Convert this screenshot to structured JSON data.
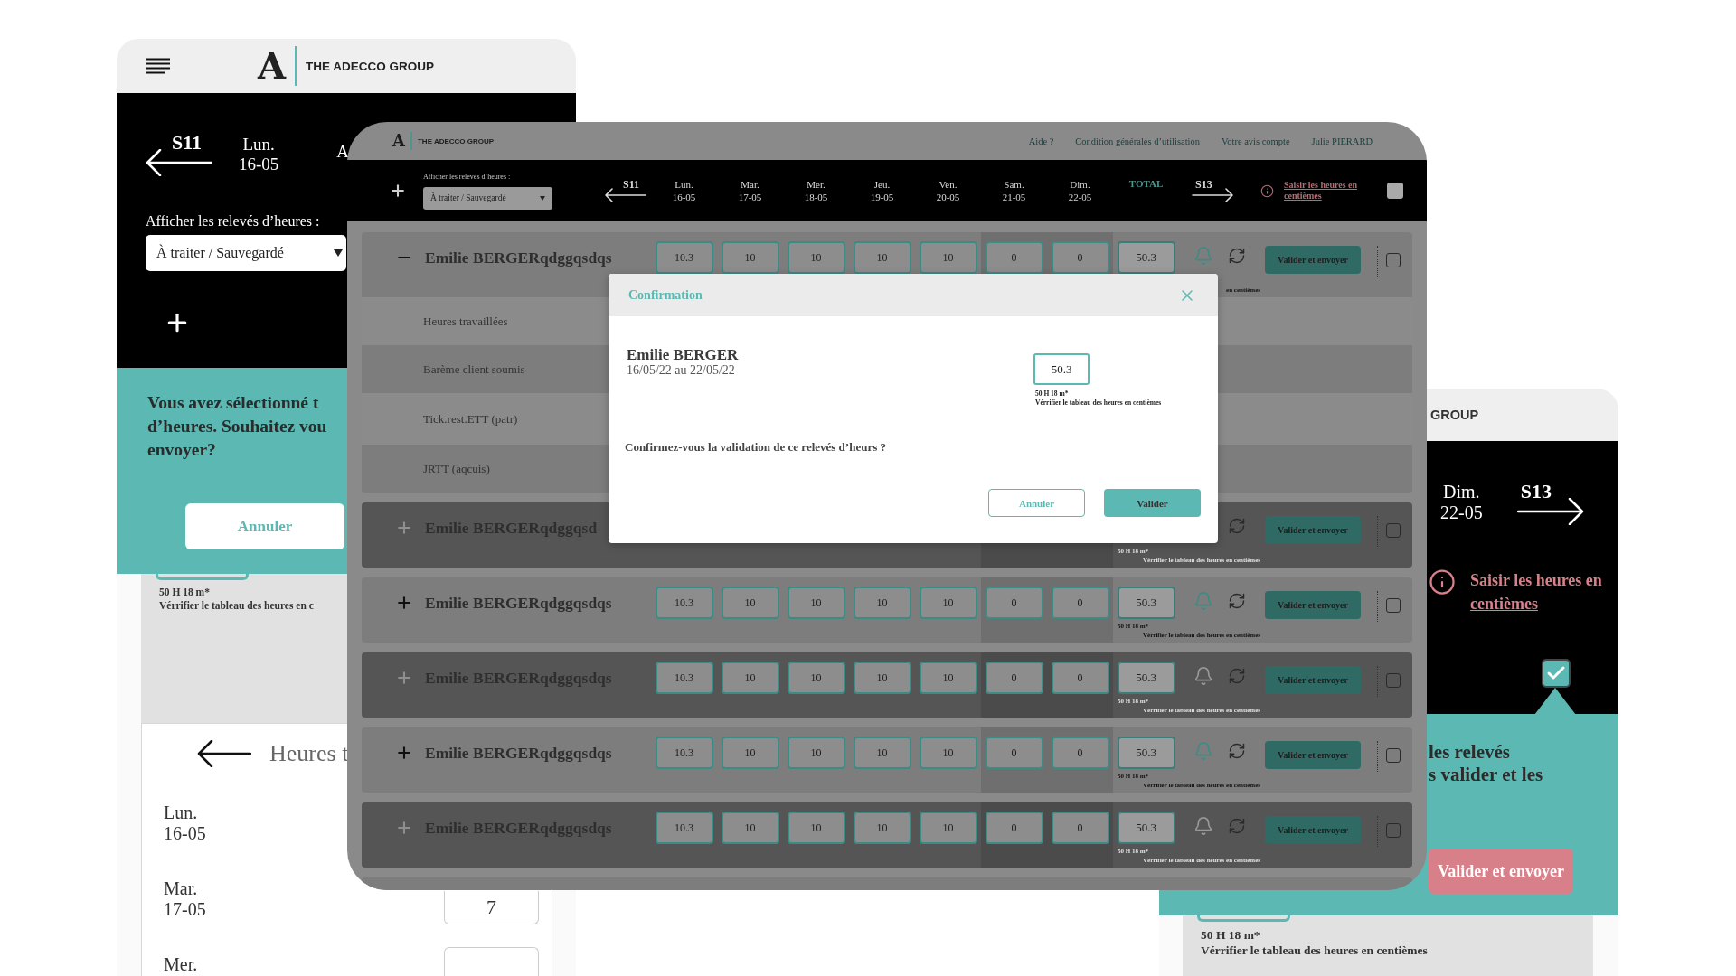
{
  "left_phone": {
    "logo": {
      "mark": "A",
      "text": "THE ADECCO GROUP"
    },
    "week": {
      "prev": "S11",
      "day": "Lun.",
      "date": "16-05",
      "next_cut": "A"
    },
    "filter": {
      "label": "Afficher les relevés d’heures :",
      "value": "À traiter / Sauvegardé"
    },
    "prompt": [
      "Vous avez sélectionné t",
      "d’heures. Souhaitez vou",
      "envoyer?"
    ],
    "cancel": "Annuler",
    "note": {
      "hours": "50 H 18 m*",
      "check": "Vérrifier le tableau des heures en c"
    },
    "detail": {
      "title": "Heures t",
      "days": [
        {
          "day": "Lun.",
          "date": "16-05",
          "field": false
        },
        {
          "day": "Mar.",
          "date": "17-05",
          "field": true,
          "value": "7"
        },
        {
          "day": "Mer.",
          "field": true
        }
      ]
    }
  },
  "right_phone": {
    "logo_text": "GROUP",
    "week": {
      "day": "Dim.",
      "date": "22-05",
      "next": "S13"
    },
    "hint_link": "Saisir les heures en centièmes",
    "select_all": {
      "checked": true
    },
    "prompt": [
      "les relevés",
      "s valider et les"
    ],
    "submit": "Valider et envoyer",
    "note": {
      "hours": "50 H 18 m*",
      "check": "Vérrifier le tableau des heures en centièmes"
    }
  },
  "desktop": {
    "logo": {
      "mark": "A",
      "text": "THE ADECCO GROUP"
    },
    "links": [
      "Aide ?",
      "Condition générales d’utilisation",
      "Votre avis compte",
      "Julie PIERARD"
    ],
    "filter": {
      "label": "Afficher les relevés d’heures :",
      "value": "À traiter / Sauvegardé"
    },
    "prev": "S11",
    "days": [
      {
        "day": "Lun.",
        "date": "16-05",
        "weekend": false
      },
      {
        "day": "Mar.",
        "date": "17-05",
        "weekend": false
      },
      {
        "day": "Mer.",
        "date": "18-05",
        "weekend": false
      },
      {
        "day": "Jeu.",
        "date": "19-05",
        "weekend": false
      },
      {
        "day": "Ven.",
        "date": "20-05",
        "weekend": false
      },
      {
        "day": "Sam.",
        "date": "21-05",
        "weekend": true
      },
      {
        "day": "Dim.",
        "date": "22-05",
        "weekend": true
      }
    ],
    "total_label": "TOTAL",
    "next": "S13",
    "hint_link": "Saisir les heures en centièmes",
    "select_all": {
      "checked": false
    },
    "rows": [
      {
        "name": "Emilie BERGERqdggqsdqs",
        "expanded": true,
        "disabled": false,
        "cells": [
          "10.3",
          "10",
          "10",
          "10",
          "10",
          "0",
          "0",
          "50.3"
        ],
        "bell_alert": true,
        "note": {
          "check": "en centièmes"
        },
        "action": "Valider et envoyer",
        "checked": false,
        "details": [
          "Heures travaillées",
          "Barème client soumis",
          "Tick.rest.ETT (patr)",
          "JRTT (aqcuis)"
        ]
      },
      {
        "name": "Emilie BERGERqdggqsd",
        "expanded": false,
        "disabled": true,
        "note": {
          "hours": "50 H 18 m*",
          "check": "Vérrifier le tableau des heures en centièmes"
        },
        "action": "Valider et envoyer",
        "checked": false
      },
      {
        "name": "Emilie BERGERqdggqsdqs",
        "expanded": false,
        "disabled": false,
        "cells": [
          "10.3",
          "10",
          "10",
          "10",
          "10",
          "0",
          "0",
          "50.3"
        ],
        "bell_alert": true,
        "note": {
          "hours": "50 H 18 m*",
          "check": "Vérrifier le tableau des heures en centièmes"
        },
        "action": "Valider et envoyer",
        "checked": false
      },
      {
        "name": "Emilie BERGERqdggqsdqs",
        "expanded": false,
        "disabled": true,
        "cells": [
          "10.3",
          "10",
          "10",
          "10",
          "10",
          "0",
          "0",
          "50.3"
        ],
        "bell_alert": false,
        "note": {
          "hours": "50 H 18 m*",
          "check": "Vérrifier le tableau des heures en centièmes"
        },
        "action": "Valider et envoyer",
        "checked": false
      },
      {
        "name": "Emilie BERGERqdggqsdqs",
        "expanded": false,
        "disabled": false,
        "cells": [
          "10.3",
          "10",
          "10",
          "10",
          "10",
          "0",
          "0",
          "50.3"
        ],
        "bell_alert": true,
        "note": {
          "hours": "50 H 18 m*",
          "check": "Vérrifier le tableau des heures en centièmes"
        },
        "action": "Valider et envoyer",
        "checked": false
      },
      {
        "name": "Emilie BERGERqdggqsdqs",
        "expanded": false,
        "disabled": true,
        "cells": [
          "10.3",
          "10",
          "10",
          "10",
          "10",
          "0",
          "0",
          "50.3"
        ],
        "bell_alert": false,
        "note": {
          "hours": "50 H 18 m*",
          "check": "Vérrifier le tableau des heures en centièmes"
        },
        "action": "Valider et envoyer",
        "checked": false
      }
    ],
    "dialog": {
      "title": "Confirmation",
      "name": "Emilie BERGER",
      "period": "16/05/22 au 22/05/22",
      "total": "50.3",
      "note": {
        "hours": "50 H 18 m*",
        "check": "Vérrifier le tableau des heures en centièmes"
      },
      "question": "Confirmez-vous la validation de ce relevés d’heurs ?",
      "buttons": [
        {
          "label": "Annuler",
          "kind": "secondary"
        },
        {
          "label": "Valider",
          "kind": "primary"
        }
      ]
    }
  }
}
